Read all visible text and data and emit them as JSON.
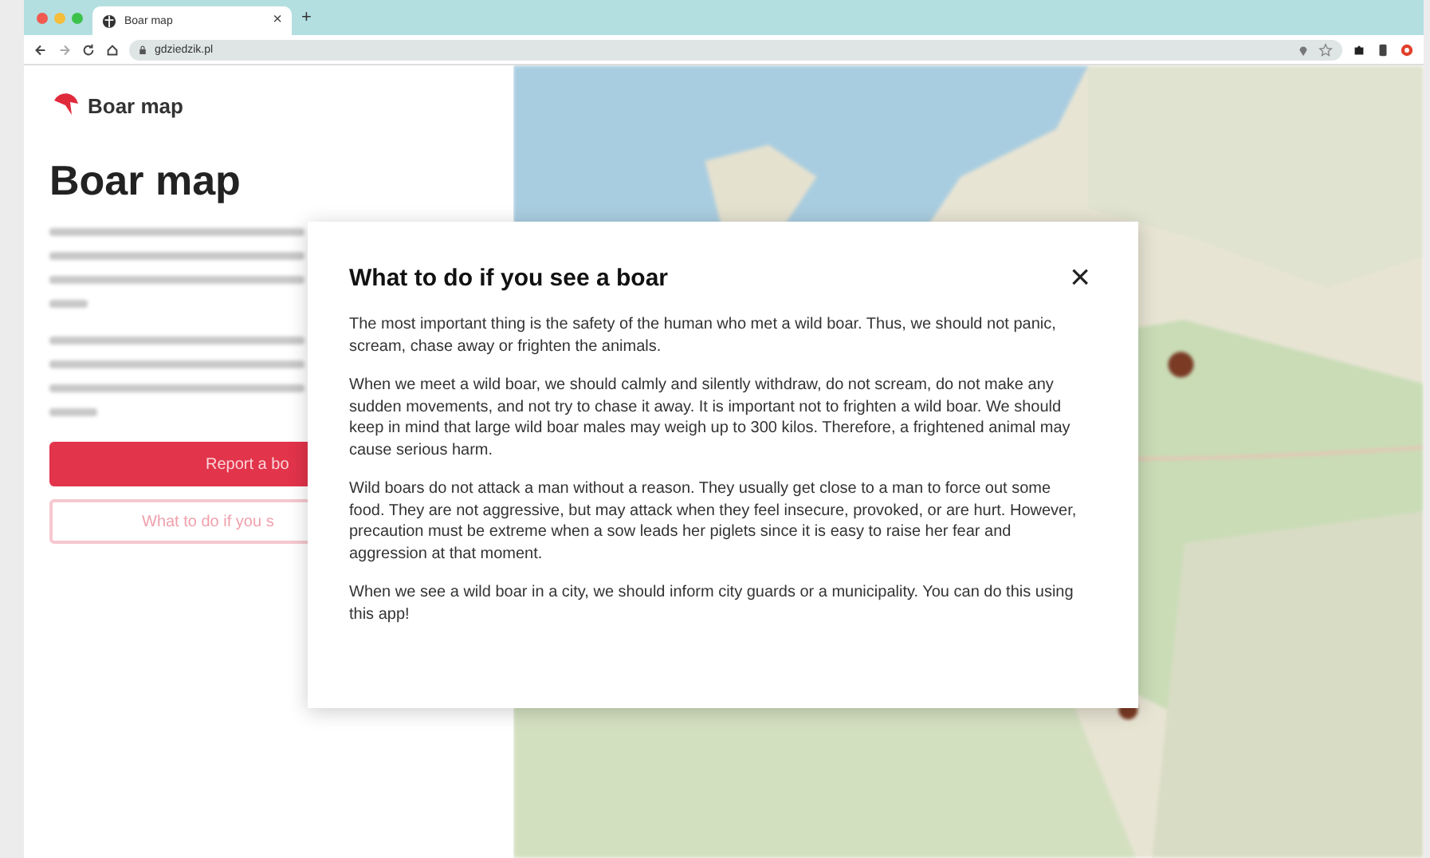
{
  "browser": {
    "tab_title": "Boar map",
    "tab_close": "×",
    "new_tab": "+",
    "url": "gdziedzik.pl"
  },
  "sidebar": {
    "logo_text": "Boar map",
    "heading": "Boar map",
    "buttons": [
      {
        "label": "Report a bo",
        "kind": "primary"
      },
      {
        "label": "What to do if you s",
        "kind": "outline"
      }
    ]
  },
  "dialog": {
    "title": "What to do if you see a boar",
    "close": "×",
    "paragraphs": [
      "The most important thing is the safety of the human who met a wild boar. Thus, we should not panic, scream, chase away or frighten the animals.",
      "When we meet a wild boar, we should calmly and silently withdraw, do not scream, do not make any sudden movements, and not try to chase it away. It is important not to frighten a wild boar. We should keep in mind that large wild boar males may weigh up to 300 kilos. Therefore, a frightened animal may cause serious harm.",
      "Wild boars do not attack a man without a reason. They usually get close to a man to force out some food. They are not aggressive, but may attack when they feel insecure, provoked, or are hurt. However, precaution must be extreme when a sow leads her piglets since it is easy to raise her fear and aggression at that moment.",
      "When we see a wild boar in a city, we should inform city guards or a municipality. You can do this using this app!"
    ]
  }
}
